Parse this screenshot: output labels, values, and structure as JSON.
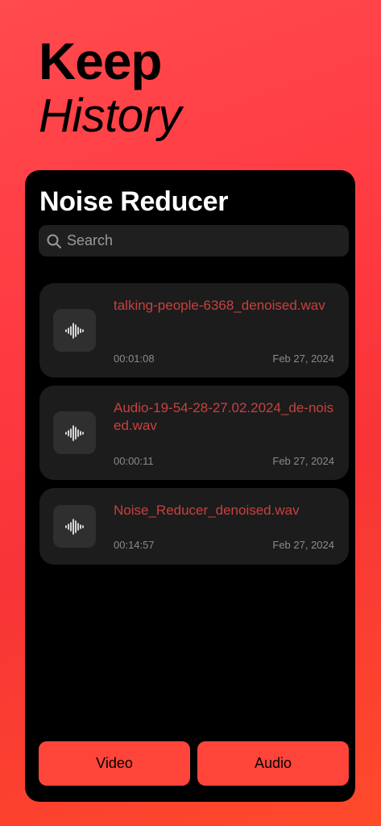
{
  "hero": {
    "line1": "Keep",
    "line2": "History"
  },
  "screen": {
    "title": "Noise Reducer",
    "search_placeholder": "Search"
  },
  "files": [
    {
      "name": "talking-people-6368_denoised.wav",
      "duration": "00:01:08",
      "date": "Feb 27, 2024",
      "icon": "waveform-icon"
    },
    {
      "name": "Audio-19-54-28-27.02.2024_de-noised.wav",
      "duration": "00:00:11",
      "date": "Feb 27, 2024",
      "icon": "waveform-icon"
    },
    {
      "name": "Noise_Reducer_denoised.wav",
      "duration": "00:14:57",
      "date": "Feb 27, 2024",
      "icon": "waveform-icon"
    }
  ],
  "buttons": {
    "video": "Video",
    "audio": "Audio"
  },
  "colors": {
    "accent": "#ff453a",
    "filename": "#c7413e"
  }
}
